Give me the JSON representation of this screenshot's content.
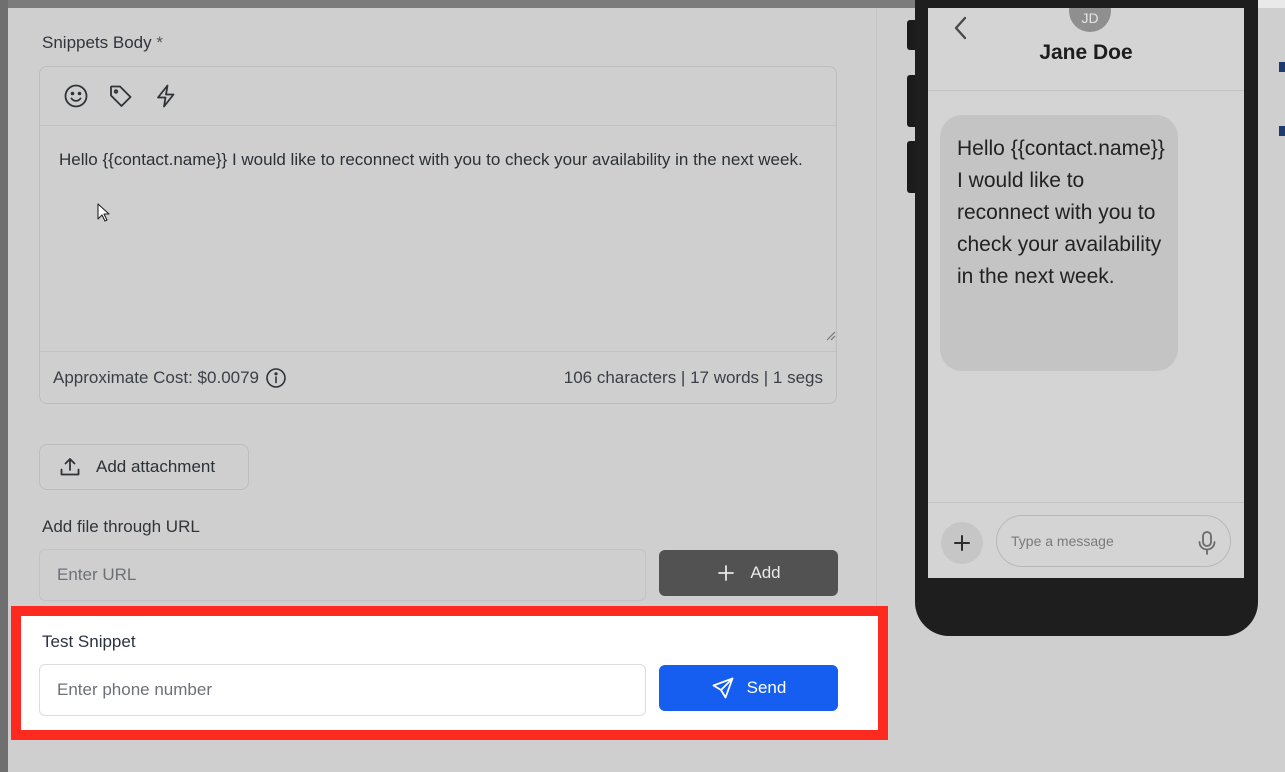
{
  "form": {
    "snippets_body_label": "Snippets Body",
    "required_mark": "*",
    "toolbar_icons": [
      "emoji-icon",
      "tag-icon",
      "lightning-icon"
    ],
    "body_text": "Hello {{contact.name}} I would like to reconnect with you to check your availability in the next week.",
    "approx_cost_label": "Approximate Cost: $0.0079",
    "stats": "106 characters | 17 words | 1 segs",
    "add_attachment_label": "Add attachment",
    "add_file_url_label": "Add file through URL",
    "url_placeholder": "Enter URL",
    "add_button_label": "Add",
    "test_snippet_label": "Test Snippet",
    "phone_placeholder": "Enter phone number",
    "send_button_label": "Send"
  },
  "preview": {
    "avatar_initials": "JD",
    "contact_name": "Jane Doe",
    "message": "Hello {{contact.name}} I would like to reconnect with you to check your availability in the next week.",
    "composer_placeholder": "Type a message"
  },
  "colors": {
    "highlight_border": "#ff2a1f",
    "send_button": "#155eef",
    "add_button": "#525252"
  }
}
